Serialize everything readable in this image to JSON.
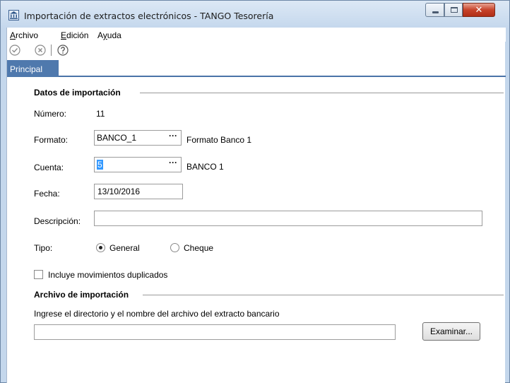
{
  "window": {
    "title": "Importación de extractos electrónicos - TANGO Tesorería",
    "minimize_icon": "minimize-icon",
    "maximize_icon": "maximize-icon",
    "close_icon": "close-icon",
    "app_icon": "bank-icon"
  },
  "menu": [
    {
      "label": "Archivo",
      "underline": "A",
      "rest": "rchivo"
    },
    {
      "label": "Edición",
      "underline": "E",
      "rest": "dición"
    },
    {
      "label": "Ayuda",
      "pre": "A",
      "underline": "y",
      "rest": "uda"
    }
  ],
  "toolbar": {
    "icons": [
      "accept-icon",
      "cancel-icon",
      "help-icon"
    ]
  },
  "tabs": [
    "Principal"
  ],
  "section_import": {
    "title": "Datos de importación",
    "numero_label": "Número:",
    "numero_value": "11",
    "formato_label": "Formato:",
    "formato_value": "BANCO_1",
    "formato_desc": "Formato Banco 1",
    "cuenta_label": "Cuenta:",
    "cuenta_value": "5",
    "cuenta_desc": "BANCO 1",
    "fecha_label": "Fecha:",
    "fecha_value": "13/10/2016",
    "descripcion_label": "Descripción:",
    "descripcion_value": "",
    "tipo_label": "Tipo:",
    "tipo_options": [
      "General",
      "Cheque"
    ],
    "tipo_selected": "General",
    "duplicados_label": "Incluye movimientos duplicados",
    "duplicados_checked": false,
    "lookup_button": "···"
  },
  "section_file": {
    "title": "Archivo de importación",
    "hint": "Ingrese el directorio y el nombre del archivo del extracto bancario",
    "path_value": "",
    "browse_label": "Examinar..."
  },
  "colors": {
    "tab_bg": "#4f79ad",
    "title_bg": "#c5d8ed",
    "close_btn": "#c7432a",
    "selection": "#3399ff"
  }
}
